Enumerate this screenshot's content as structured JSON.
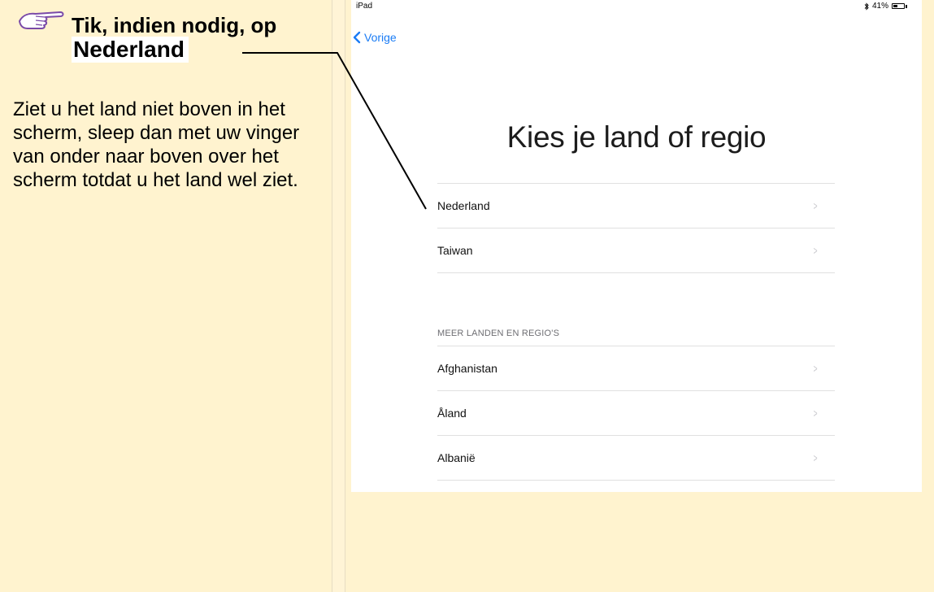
{
  "instruction_panel": {
    "tip_title": "Tik, indien nodig, op",
    "tip_target": "Nederland",
    "body": "Ziet u het land niet boven in het scherm, sleep dan met uw vinger van onder naar boven over het scherm totdat u het land wel ziet.",
    "hand_icon": "pointing-hand-icon"
  },
  "status_bar": {
    "device": "iPad",
    "battery": "41%",
    "battery_level": 0.41,
    "bluetooth_icon": "bluetooth-icon"
  },
  "nav": {
    "back_label": "Vorige"
  },
  "page": {
    "title": "Kies je land of regio"
  },
  "suggested": [
    {
      "label": "Nederland"
    },
    {
      "label": "Taiwan"
    }
  ],
  "more_section": {
    "header": "MEER LANDEN EN REGIO'S",
    "items": [
      {
        "label": "Afghanistan"
      },
      {
        "label": "Åland"
      },
      {
        "label": "Albanië"
      }
    ]
  },
  "colors": {
    "accent": "#1a7cf5",
    "panel_background": "#fff3cf",
    "chevron": "#c7c7cc"
  }
}
